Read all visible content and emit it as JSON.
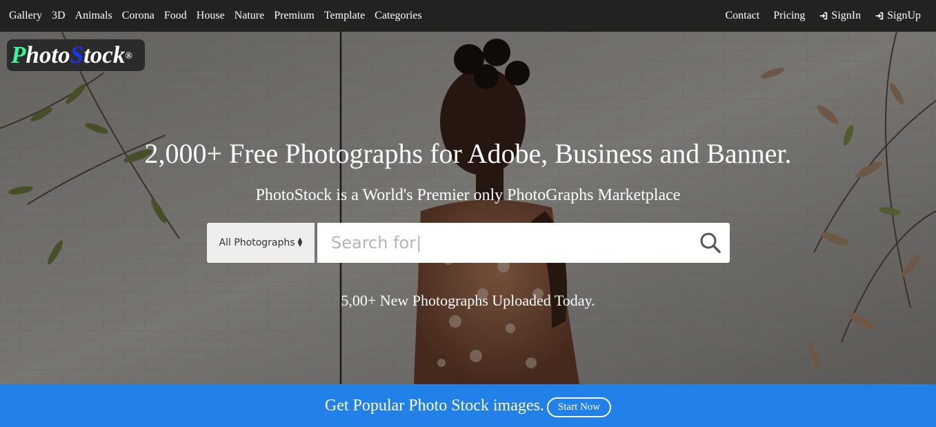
{
  "nav": {
    "left": [
      "Gallery",
      "3D",
      "Animals",
      "Corona",
      "Food",
      "House",
      "Nature",
      "Premium",
      "Template",
      "Categories"
    ],
    "contact": "Contact",
    "pricing": "Pricing",
    "signin": "SignIn",
    "signup": "SignUp"
  },
  "logo": {
    "p": "P",
    "hoto": "hoto",
    "s": "S",
    "tock": "tock",
    "reg": "®"
  },
  "hero": {
    "headline": "2,000+ Free Photographs for Adobe, Business and Banner.",
    "subline": "PhotoStock is a World's Premier only PhotoGraphs Marketplace",
    "select_value": "All Photographs",
    "search_placeholder": "Search for|",
    "uploaded": "5,00+ New Photographs Uploaded Today."
  },
  "cta": {
    "text": "Get Popular Photo Stock images.",
    "button": "Start Now"
  },
  "icons": {
    "signin": "sign-in-icon",
    "signup": "sign-in-icon",
    "search": "search-icon",
    "select_caret": "sort-caret-icon"
  },
  "colors": {
    "nav_bg": "#222222",
    "cta_bg": "#2181e8",
    "logo_p": "#33ff99",
    "logo_s": "#1a33ff"
  }
}
